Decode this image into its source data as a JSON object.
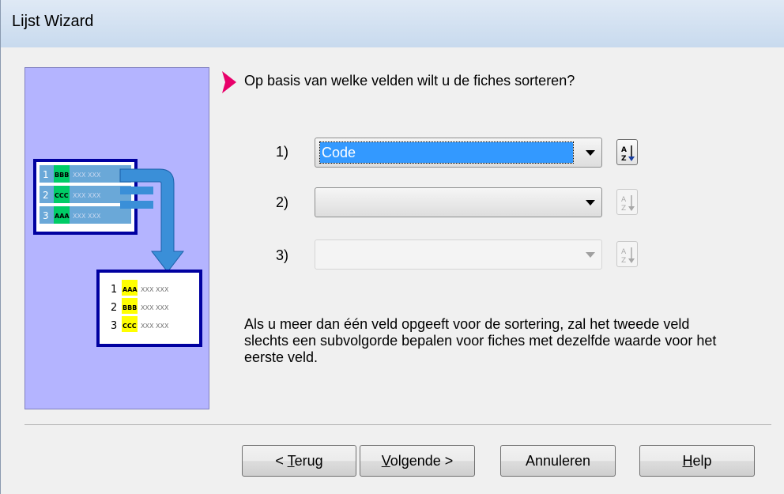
{
  "window": {
    "title": "Lijst Wizard"
  },
  "prompt": "Op basis van welke velden wilt u de fiches sorteren?",
  "sort_fields": [
    {
      "label": "1)",
      "value": "Code",
      "enabled": true
    },
    {
      "label": "2)",
      "value": "",
      "enabled": true
    },
    {
      "label": "3)",
      "value": "",
      "enabled": false
    }
  ],
  "note": "Als u meer dan één veld opgeeft voor de sortering, zal het tweede veld slechts een subvolgorde bepalen voor fiches met dezelfde waarde voor het eerste veld.",
  "illustration": {
    "before": [
      {
        "num": "1",
        "key": "BBB",
        "rest": "XXX XXX"
      },
      {
        "num": "2",
        "key": "CCC",
        "rest": "XXX XXX"
      },
      {
        "num": "3",
        "key": "AAA",
        "rest": "XXX XXX"
      }
    ],
    "after": [
      {
        "num": "1",
        "key": "AAA",
        "rest": "XXX XXX"
      },
      {
        "num": "2",
        "key": "BBB",
        "rest": "XXX XXX"
      },
      {
        "num": "3",
        "key": "CCC",
        "rest": "XXX XXX"
      }
    ]
  },
  "buttons": {
    "back": {
      "pre": "< ",
      "mnemonic": "T",
      "post": "erug"
    },
    "next": {
      "pre": "",
      "mnemonic": "V",
      "post": "olgende >"
    },
    "cancel": "Annuleren",
    "help": {
      "pre": "",
      "mnemonic": "H",
      "post": "elp"
    }
  },
  "sort_button_icon": "sort-ascending-az-icon"
}
